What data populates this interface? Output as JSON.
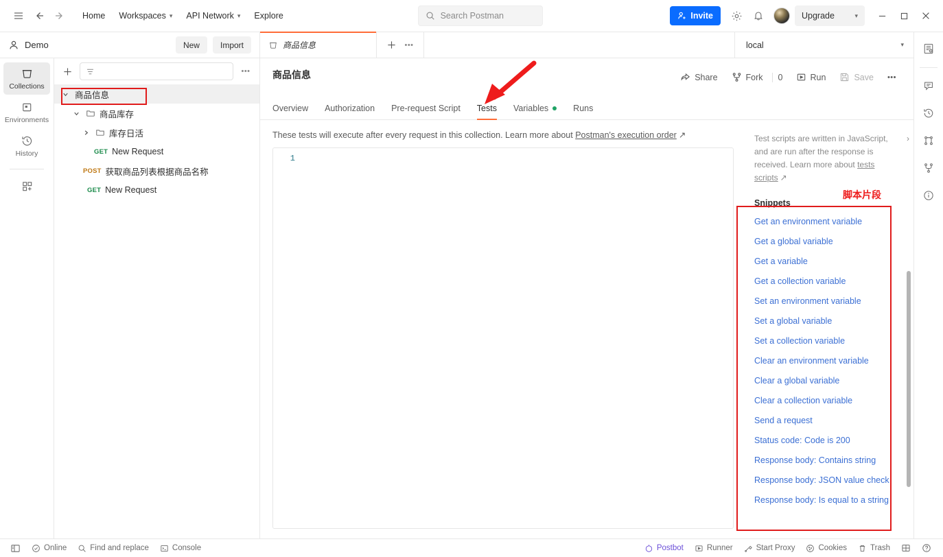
{
  "topbar": {
    "hamburger_icon": "menu-icon",
    "back_icon": "arrow-left-icon",
    "forward_icon": "arrow-right-icon",
    "links": [
      {
        "label": "Home",
        "caret": false
      },
      {
        "label": "Workspaces",
        "caret": true
      },
      {
        "label": "API Network",
        "caret": true
      },
      {
        "label": "Explore",
        "caret": false
      }
    ],
    "search_placeholder": "Search Postman",
    "invite_label": "Invite",
    "settings_icon": "gear-icon",
    "notifications_icon": "bell-icon",
    "avatar": "user-avatar",
    "upgrade_label": "Upgrade",
    "minimize_label": "—",
    "maximize_label": "□",
    "close_label": "✕"
  },
  "sidebar": {
    "workspace_name": "Demo",
    "new_label": "New",
    "import_label": "Import",
    "rail": [
      {
        "label": "Collections",
        "icon": "collections-icon",
        "active": true
      },
      {
        "label": "Environments",
        "icon": "environments-icon",
        "active": false
      },
      {
        "label": "History",
        "icon": "history-icon",
        "active": false
      }
    ],
    "add_more_icon": "add-modules-icon",
    "filter_placeholder": "",
    "tree": [
      {
        "label": "商品信息",
        "type": "collection",
        "indent": 0,
        "chevron": "down",
        "selected": true
      },
      {
        "label": "商品库存",
        "type": "folder",
        "indent": 1,
        "chevron": "down",
        "selected": false
      },
      {
        "label": "库存日活",
        "type": "folder",
        "indent": 2,
        "chevron": "right",
        "selected": false
      },
      {
        "label": "New Request",
        "type": "request",
        "method": "GET",
        "indent": 3,
        "selected": false
      },
      {
        "label": "获取商品列表根据商品名称",
        "type": "request",
        "method": "POST",
        "indent": 2,
        "selected": false
      },
      {
        "label": "New Request",
        "type": "request",
        "method": "GET",
        "indent": 2,
        "selected": false
      }
    ]
  },
  "tabstrip": {
    "open_tab": "商品信息",
    "open_tab_icon": "collection-icon",
    "new_tab_icon": "plus-icon",
    "tab_options_icon": "more-options-icon",
    "environment": "local"
  },
  "collection": {
    "title": "商品信息",
    "actions": {
      "share": "Share",
      "fork": "Fork",
      "fork_count": "0",
      "run": "Run",
      "save": "Save",
      "more": "•••"
    },
    "tabs": [
      {
        "label": "Overview",
        "active": false,
        "dot": false
      },
      {
        "label": "Authorization",
        "active": false,
        "dot": false
      },
      {
        "label": "Pre-request Script",
        "active": false,
        "dot": false
      },
      {
        "label": "Tests",
        "active": true,
        "dot": false
      },
      {
        "label": "Variables",
        "active": false,
        "dot": true
      },
      {
        "label": "Runs",
        "active": false,
        "dot": false
      }
    ]
  },
  "tests_panel": {
    "hint_text": "These tests will execute after every request in this collection. Learn more about ",
    "hint_link": "Postman's execution order",
    "hint_link_arrow": "↗",
    "editor_line_number": "1",
    "editor_content": ""
  },
  "snippets_panel": {
    "intro_text": "Test scripts are written in JavaScript, and are run after the response is received. Learn more about ",
    "intro_link": "tests scripts",
    "intro_link_arrow": "↗",
    "collapse_icon": "chevron-right-icon",
    "heading": "Snippets",
    "items": [
      "Get an environment variable",
      "Get a global variable",
      "Get a variable",
      "Get a collection variable",
      "Set an environment variable",
      "Set a global variable",
      "Set a collection variable",
      "Clear an environment variable",
      "Clear a global variable",
      "Clear a collection variable",
      "Send a request",
      "Status code: Code is 200",
      "Response body: Contains string",
      "Response body: JSON value check",
      "Response body: Is equal to a string"
    ]
  },
  "right_rail": [
    {
      "icon": "documentation-icon",
      "name": "documentation"
    },
    {
      "icon": "comments-icon",
      "name": "comments"
    },
    {
      "icon": "activity-icon",
      "name": "activity-feed"
    },
    {
      "icon": "changelog-icon",
      "name": "changelog"
    },
    {
      "icon": "forks-icon",
      "name": "forks"
    },
    {
      "icon": "info-icon",
      "name": "info"
    }
  ],
  "statusbar": {
    "sidebar_toggle_icon": "sidebar-toggle-icon",
    "left_items": [
      {
        "label": "Online",
        "icon": "check-circle-icon"
      },
      {
        "label": "Find and replace",
        "icon": "search-icon"
      },
      {
        "label": "Console",
        "icon": "console-icon"
      }
    ],
    "right_items": [
      {
        "label": "Postbot",
        "icon": "postbot-icon"
      },
      {
        "label": "Runner",
        "icon": "runner-icon"
      },
      {
        "label": "Start Proxy",
        "icon": "proxy-icon"
      },
      {
        "label": "Cookies",
        "icon": "cookies-icon"
      },
      {
        "label": "Trash",
        "icon": "trash-icon"
      }
    ],
    "layout_icon": "two-pane-icon",
    "help_icon": "help-icon"
  },
  "annotations": {
    "snippets_label": "脚本片段",
    "accent_red": "#e01b1b",
    "arrow_red": "#ee1c1c",
    "brand_orange": "#ff6c37",
    "link_blue": "#3b6fd4",
    "invite_blue": "#0a6cff"
  }
}
